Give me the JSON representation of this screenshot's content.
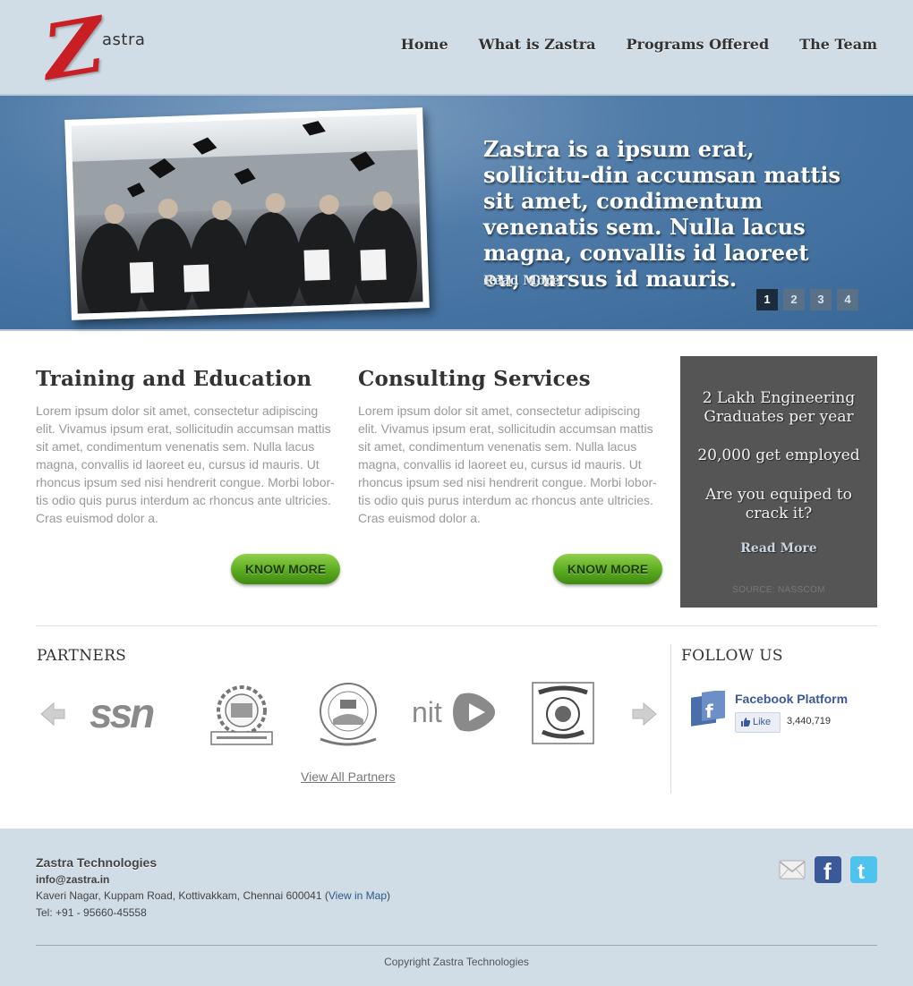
{
  "brand": {
    "logo_letter": "Z",
    "logo_text": "astra"
  },
  "nav": {
    "items": [
      "Home",
      "What is Zastra",
      "Programs Offered",
      "The Team"
    ]
  },
  "hero": {
    "headline": "Zastra is a ipsum erat, sollicitu-din accumsan mattis sit amet, condimentum venenatis sem. Nulla lacus magna, convallis id laoreet eu, cursus id mauris.",
    "read_more": "Read More",
    "pages": [
      "1",
      "2",
      "3",
      "4"
    ],
    "active_page": 1
  },
  "columns": [
    {
      "title": "Training and Education",
      "body": "Lorem ipsum dolor sit amet, consectetur adipiscing elit. Vivamus ipsum erat, sollicitudin accumsan mattis sit amet, condimentum venenatis sem. Nulla lacus magna, convallis id laoreet eu, cursus id mauris. Ut rhoncus ipsum sed nisi hendrerit congue. Morbi lobor-tis odio quis purus interdum ac rhoncus ante ultricies. Cras euismod dolor a.",
      "button": "KNOW MORE"
    },
    {
      "title": "Consulting Services",
      "body": "Lorem ipsum dolor sit amet, consectetur adipiscing elit. Vivamus ipsum erat, sollicitudin accumsan mattis sit amet, condimentum venenatis sem. Nulla lacus magna, convallis id laoreet eu, cursus id mauris. Ut rhoncus ipsum sed nisi hendrerit congue. Morbi lobor-tis odio quis purus interdum ac rhoncus ante ultricies. Cras euismod dolor a.",
      "button": "KNOW MORE"
    }
  ],
  "stats": {
    "line1": "2 Lakh Engineering Graduates per year",
    "line2": "20,000 get employed",
    "line3": "Are you equiped to crack it?",
    "read_more": "Read More",
    "source": "SOURCE: NASSCOM"
  },
  "partners": {
    "title": "PARTNERS",
    "logos": [
      "ssn",
      "anna-university",
      "vit-university",
      "nit",
      "college-crest"
    ],
    "ssn_text": "ssn",
    "nit_text": "nit",
    "view_all": "View All Partners"
  },
  "follow": {
    "title": "FOLLOW US",
    "fb_title": "Facebook Platform",
    "like_label": "Like",
    "like_count": "3,440,719"
  },
  "footer": {
    "company": "Zastra Technologies",
    "email": "info@zastra.in",
    "address": "Kaveri Nagar, Kuppam Road, Kottivakkam, Chennai 600041",
    "map_link": "View in Map",
    "tel": "Tel: +91 - 95660-45558",
    "copyright": "Copyright Zastra Technologies",
    "social_icons": [
      "mail-icon",
      "facebook-icon",
      "twitter-icon"
    ]
  },
  "colors": {
    "header_bg": "#d0dce6",
    "hero_blue": "#386898",
    "button_green": "#5cab1f",
    "stats_bg": "#555555",
    "facebook_blue": "#3b5998"
  }
}
